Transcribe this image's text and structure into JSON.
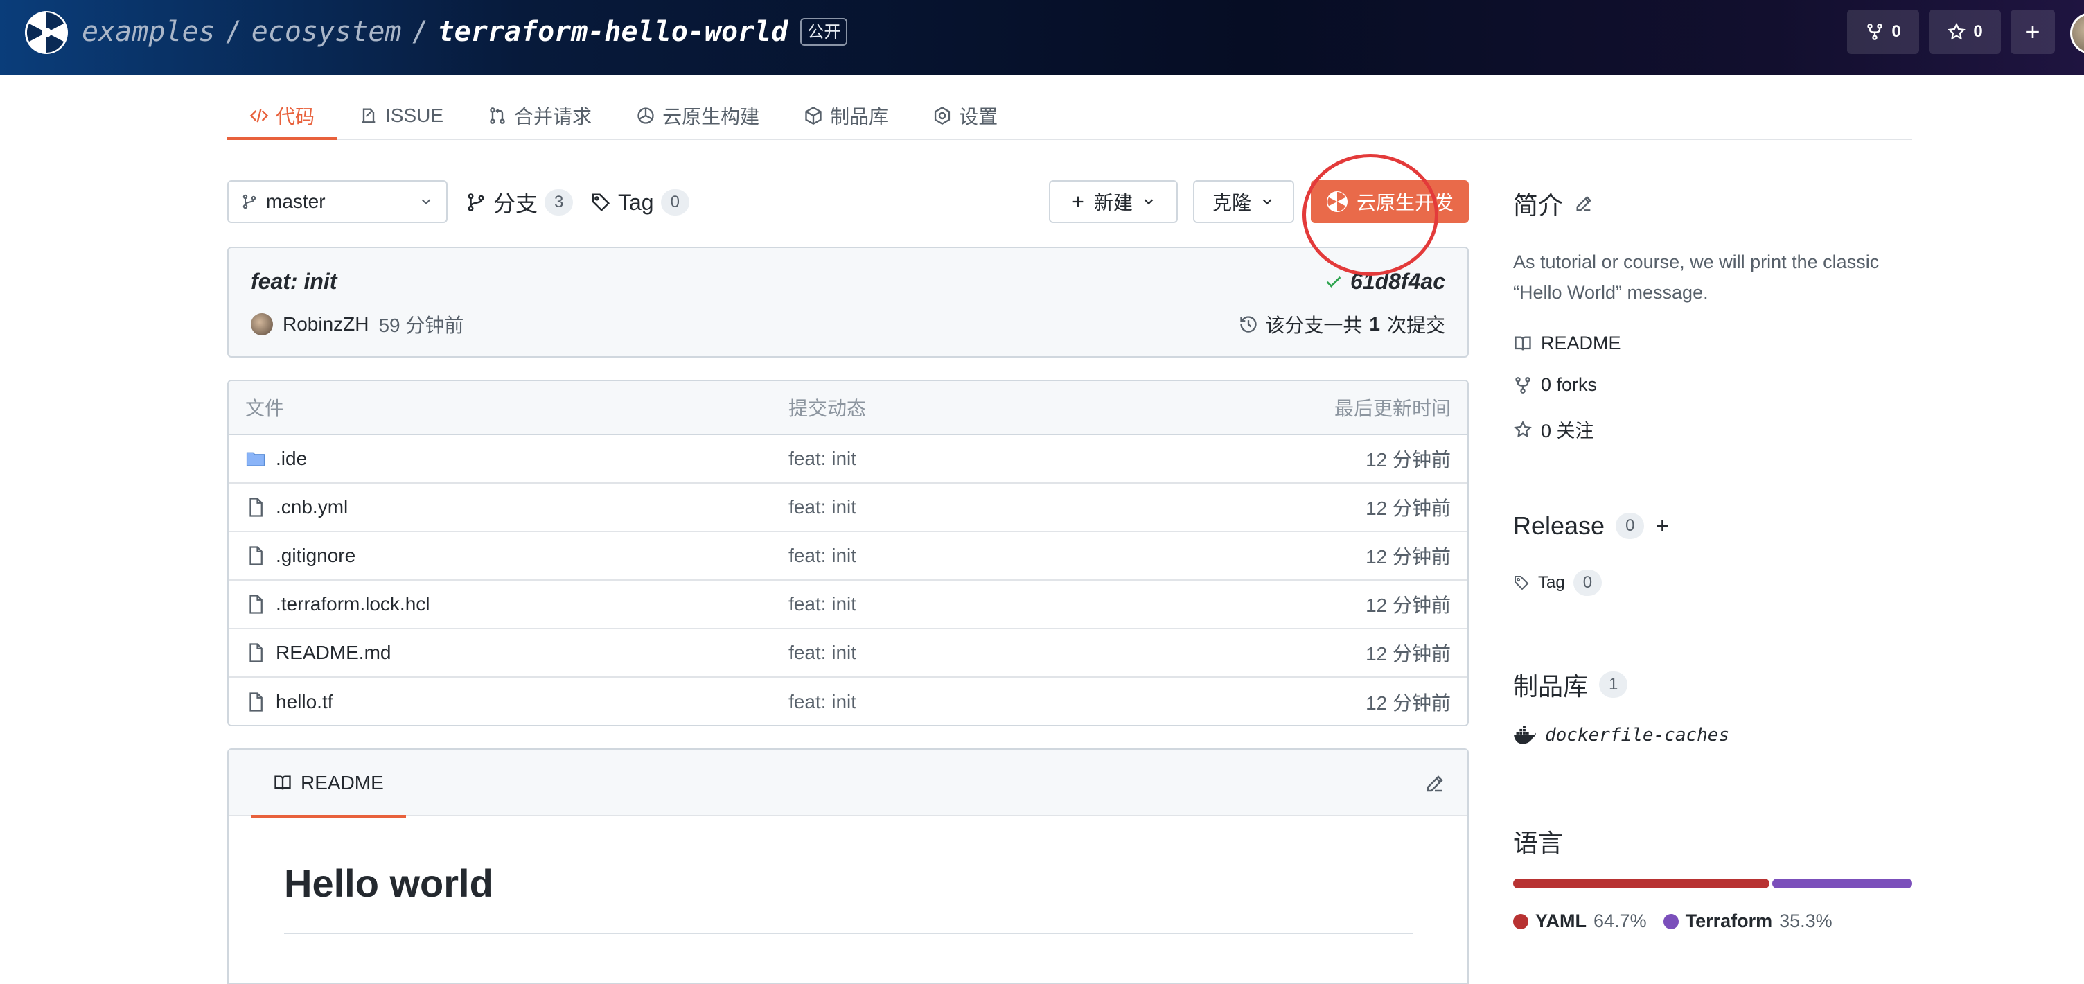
{
  "header": {
    "crumbs": [
      "examples",
      "ecosystem",
      "terraform-hello-world"
    ],
    "separator": "/",
    "public_badge": "公开",
    "fork_count": "0",
    "star_count": "0",
    "plus_label": "+"
  },
  "tabs": [
    {
      "label": "代码",
      "icon": "code-icon",
      "active": true
    },
    {
      "label": "ISSUE",
      "icon": "issue-icon"
    },
    {
      "label": "合并请求",
      "icon": "pull-request-icon"
    },
    {
      "label": "云原生构建",
      "icon": "build-icon"
    },
    {
      "label": "制品库",
      "icon": "package-icon"
    },
    {
      "label": "设置",
      "icon": "gear-icon"
    }
  ],
  "toolbar": {
    "branch": "master",
    "branches_label": "分支",
    "branches_count": "3",
    "tags_label": "Tag",
    "tags_count": "0",
    "new_label": "新建",
    "clone_label": "克隆",
    "cloud_dev_label": "云原生开发"
  },
  "commit": {
    "title": "feat: init",
    "hash": "61d8f4ac",
    "author": "RobinzZH",
    "time": "59 分钟前",
    "count_prefix": "该分支一共",
    "count": "1",
    "count_suffix": "次提交"
  },
  "files": {
    "headers": {
      "name": "文件",
      "message": "提交动态",
      "time": "最后更新时间"
    },
    "rows": [
      {
        "name": ".ide",
        "type": "folder",
        "message": "feat: init",
        "time": "12 分钟前"
      },
      {
        "name": ".cnb.yml",
        "type": "file",
        "message": "feat: init",
        "time": "12 分钟前"
      },
      {
        "name": ".gitignore",
        "type": "file",
        "message": "feat: init",
        "time": "12 分钟前"
      },
      {
        "name": ".terraform.lock.hcl",
        "type": "file",
        "message": "feat: init",
        "time": "12 分钟前"
      },
      {
        "name": "README.md",
        "type": "file",
        "message": "feat: init",
        "time": "12 分钟前"
      },
      {
        "name": "hello.tf",
        "type": "file",
        "message": "feat: init",
        "time": "12 分钟前"
      }
    ]
  },
  "readme": {
    "tab_label": "README",
    "heading": "Hello world"
  },
  "sidebar": {
    "about_title": "简介",
    "description": "As tutorial or course, we will print the classic “Hello World” message.",
    "readme_link": "README",
    "forks": "0 forks",
    "stars": "0 关注",
    "release_title": "Release",
    "release_count": "0",
    "release_add": "+",
    "tag_label": "Tag",
    "tag_count": "0",
    "packages_title": "制品库",
    "packages_count": "1",
    "package_name": "dockerfile-caches",
    "languages_title": "语言",
    "languages": [
      {
        "name": "YAML",
        "percent": "64.7%",
        "value": 64.7,
        "color": "#b83232"
      },
      {
        "name": "Terraform",
        "percent": "35.3%",
        "value": 35.3,
        "color": "#7b4fbb"
      }
    ]
  },
  "colors": {
    "accent": "#e8613c",
    "primary_button": "#e96a4a",
    "highlight_ring": "#e33a3a"
  }
}
